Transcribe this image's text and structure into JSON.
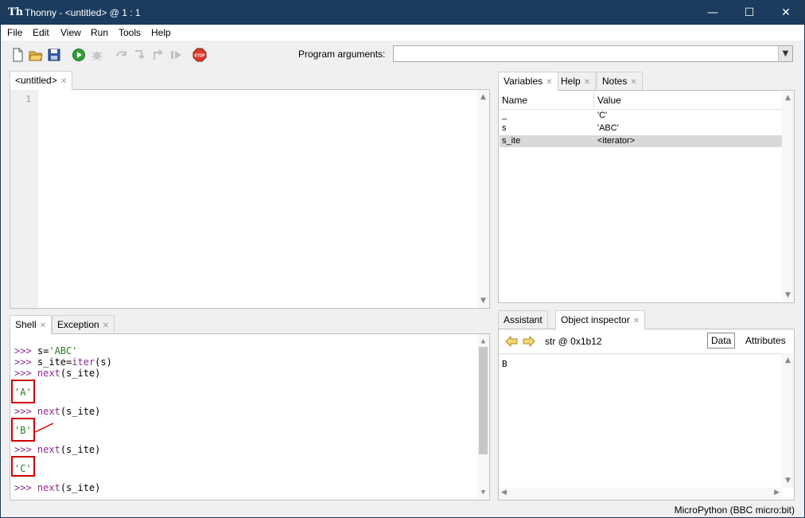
{
  "window": {
    "title": "Thonny  -  <untitled>  @  1 : 1",
    "app_icon": "Th",
    "minimize": "—",
    "maximize": "☐",
    "close": "✕"
  },
  "menu": [
    "File",
    "Edit",
    "View",
    "Run",
    "Tools",
    "Help"
  ],
  "toolbar": {
    "program_arguments_label": "Program arguments:",
    "program_arguments_value": "",
    "stop_label": "STOP"
  },
  "editor": {
    "tab_label": "<untitled>",
    "line_numbers": [
      "1"
    ]
  },
  "shell": {
    "tabs": [
      "Shell",
      "Exception"
    ],
    "lines": [
      {
        "prompt": ">>> ",
        "code": "s='ABC'"
      },
      {
        "prompt": ">>> ",
        "code": "s_ite=iter(s)"
      },
      {
        "prompt": ">>> ",
        "code": "next(s_ite)"
      },
      {
        "prompt": "",
        "code": "'A'"
      },
      {
        "prompt": ">>> ",
        "code": "next(s_ite)"
      },
      {
        "prompt": "",
        "code": "'B'"
      },
      {
        "prompt": ">>> ",
        "code": "next(s_ite)"
      },
      {
        "prompt": "",
        "code": "'C'"
      },
      {
        "prompt": ">>> ",
        "code": "next(s_ite)"
      }
    ]
  },
  "variables": {
    "tabs": [
      "Variables",
      "Help",
      "Notes"
    ],
    "col_name": "Name",
    "col_value": "Value",
    "rows": [
      {
        "name": "_",
        "value": "'C'"
      },
      {
        "name": "s",
        "value": "'ABC'"
      },
      {
        "name": "s_ite",
        "value": "<iterator>"
      }
    ],
    "selected_row": 2
  },
  "inspector": {
    "tabs": [
      "Assistant",
      "Object inspector"
    ],
    "object_label": "str @ 0x1b12",
    "data_button": "Data",
    "attributes_button": "Attributes",
    "content": "B"
  },
  "status": {
    "interpreter": "MicroPython (BBC micro:bit)"
  },
  "colors": {
    "titlebar": "#1b3b5f",
    "highlight_box": "#d00000",
    "prompt": "#8a2f8a",
    "selection": "#d9d9d9"
  }
}
